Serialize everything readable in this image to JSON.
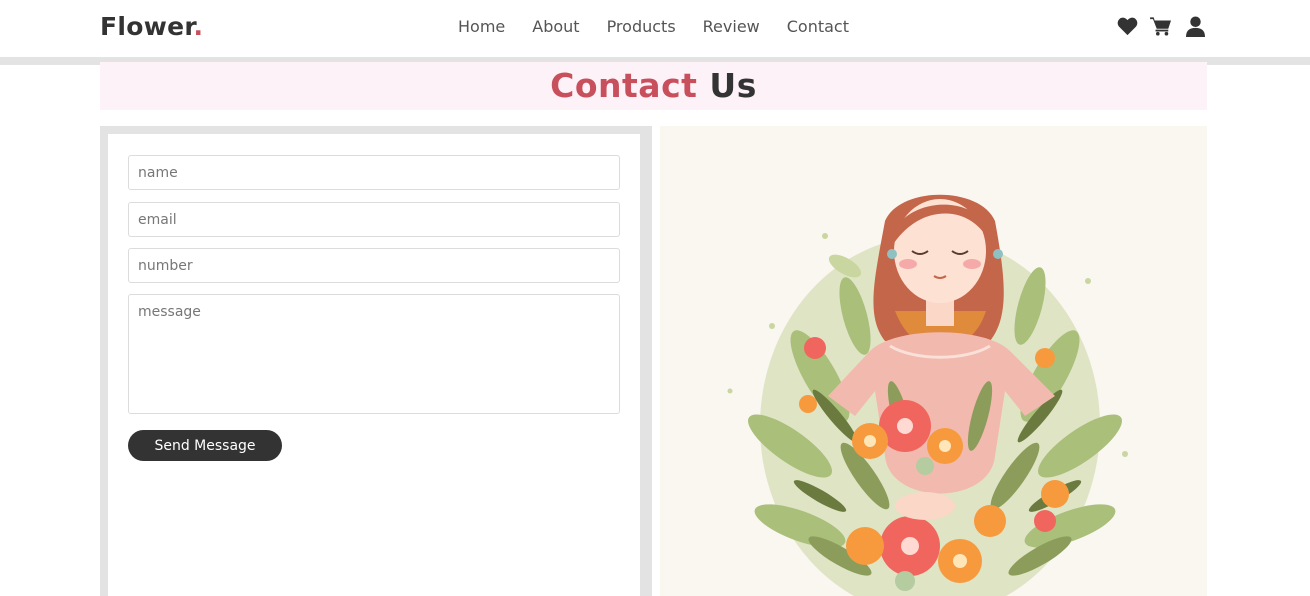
{
  "header": {
    "logo_text": "Flower",
    "logo_dot": ".",
    "nav": [
      {
        "label": "Home"
      },
      {
        "label": "About"
      },
      {
        "label": "Products"
      },
      {
        "label": "Review"
      },
      {
        "label": "Contact"
      }
    ],
    "icons": [
      "heart-icon",
      "shopping-cart-icon",
      "user-icon"
    ]
  },
  "section": {
    "title_accent": "Contact",
    "title_rest": "Us"
  },
  "form": {
    "name_placeholder": "name",
    "email_placeholder": "email",
    "number_placeholder": "number",
    "message_placeholder": "message",
    "submit_label": "Send Message"
  },
  "colors": {
    "accent": "#c84f5c",
    "dark": "#333333",
    "heading_band": "#fdf2f7",
    "image_background": "#faf6f0"
  }
}
